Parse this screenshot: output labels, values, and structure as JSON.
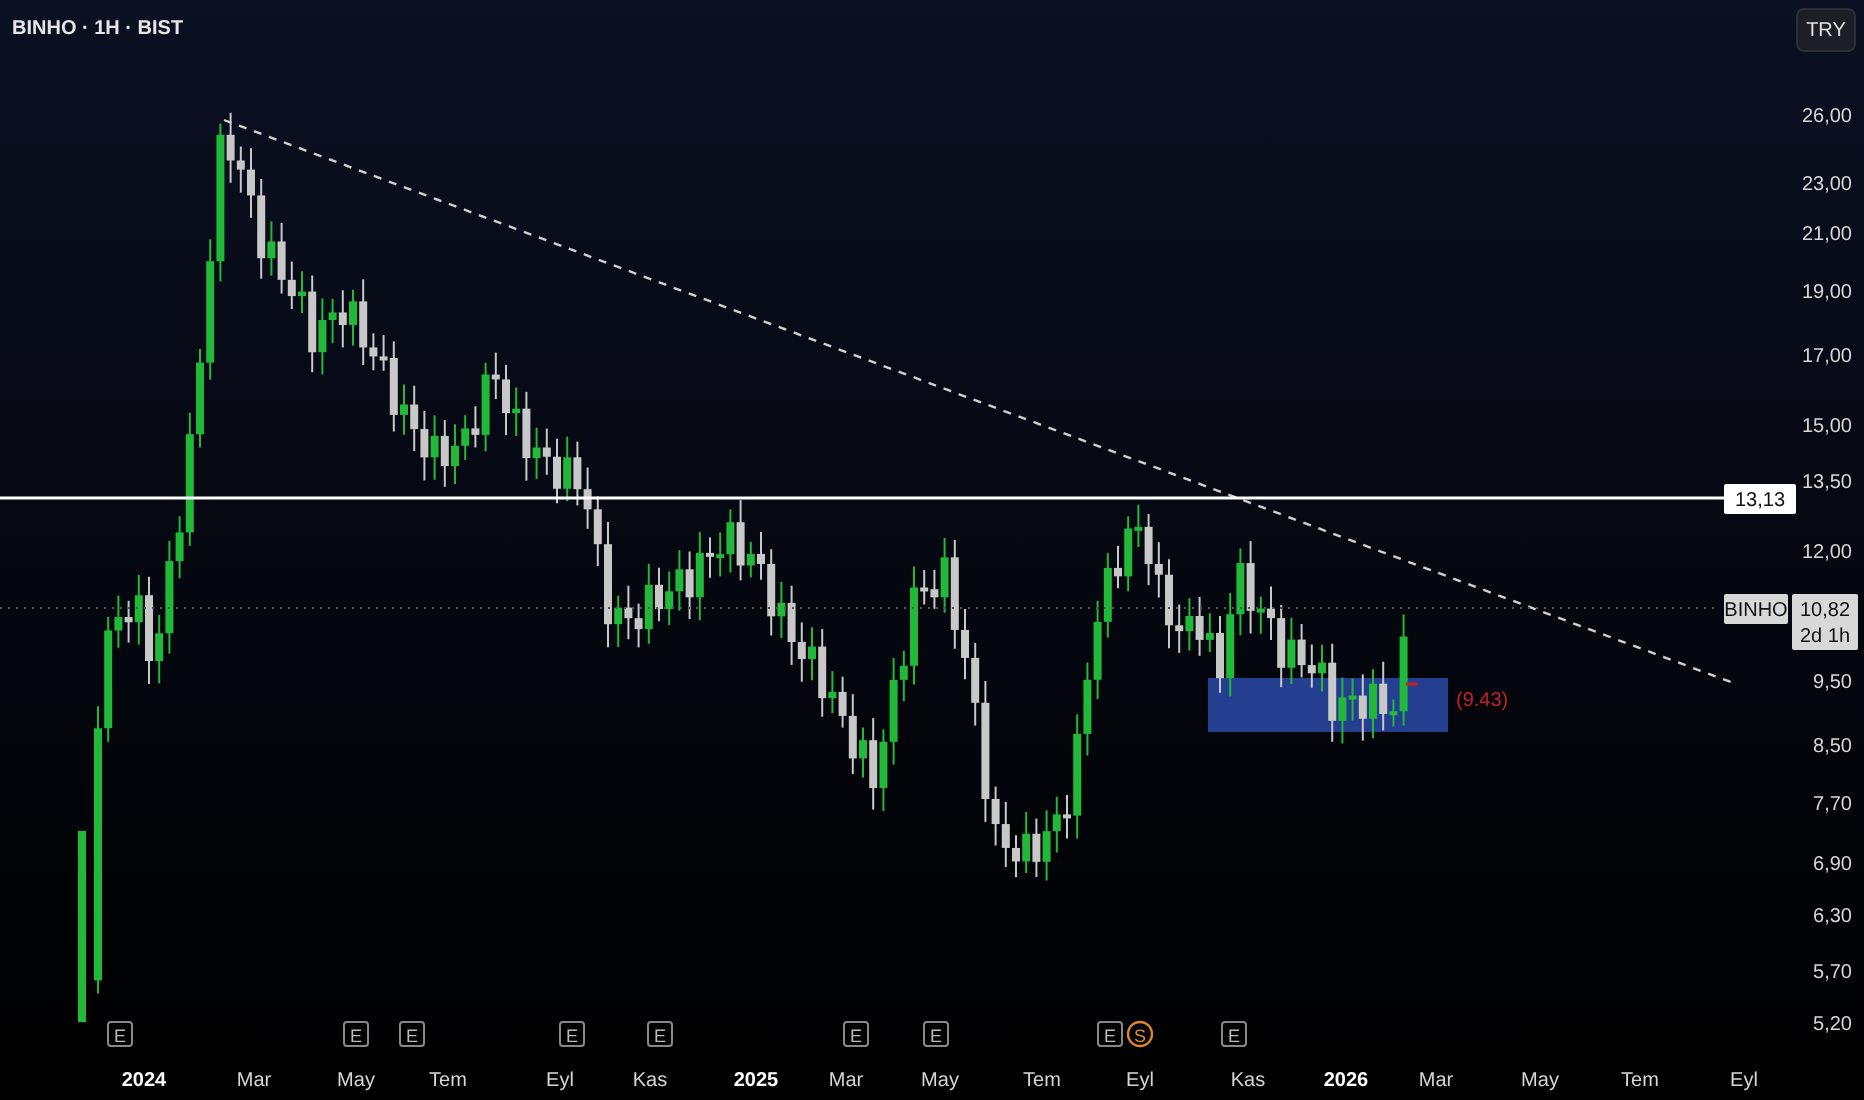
{
  "chart_title": "BINHO · 1H · BIST",
  "currency_button": "TRY",
  "price_axis": [
    "26,00",
    "23,00",
    "21,00",
    "19,00",
    "17,00",
    "15,00",
    "13,50",
    "12,00",
    "9,50",
    "8,50",
    "7,70",
    "6,90",
    "6,30",
    "5,70",
    "5,20"
  ],
  "level_line": {
    "label": "13,13"
  },
  "current_price": {
    "symbol": "BINHO",
    "value": "10,82",
    "countdown": "2d 1h"
  },
  "annotation": "(9.43)",
  "event_markers": [
    {
      "kind": "earnings",
      "label": "E"
    },
    {
      "kind": "earnings",
      "label": "E"
    },
    {
      "kind": "earnings",
      "label": "E"
    },
    {
      "kind": "earnings",
      "label": "E"
    },
    {
      "kind": "earnings",
      "label": "E"
    },
    {
      "kind": "earnings",
      "label": "E"
    },
    {
      "kind": "earnings",
      "label": "E"
    },
    {
      "kind": "earnings",
      "label": "E"
    },
    {
      "kind": "dividend",
      "label": "S"
    },
    {
      "kind": "earnings",
      "label": "E"
    }
  ],
  "time_axis": [
    {
      "kind": "year",
      "label": "2024"
    },
    {
      "kind": "month",
      "label": "Mar"
    },
    {
      "kind": "month",
      "label": "May"
    },
    {
      "kind": "month",
      "label": "Tem"
    },
    {
      "kind": "month",
      "label": "Eyl"
    },
    {
      "kind": "month",
      "label": "Kas"
    },
    {
      "kind": "year",
      "label": "2025"
    },
    {
      "kind": "month",
      "label": "Mar"
    },
    {
      "kind": "month",
      "label": "May"
    },
    {
      "kind": "month",
      "label": "Tem"
    },
    {
      "kind": "month",
      "label": "Eyl"
    },
    {
      "kind": "month",
      "label": "Kas"
    },
    {
      "kind": "year",
      "label": "2026"
    },
    {
      "kind": "month",
      "label": "Mar"
    },
    {
      "kind": "month",
      "label": "May"
    },
    {
      "kind": "month",
      "label": "Tem"
    },
    {
      "kind": "month",
      "label": "Eyl"
    }
  ]
}
